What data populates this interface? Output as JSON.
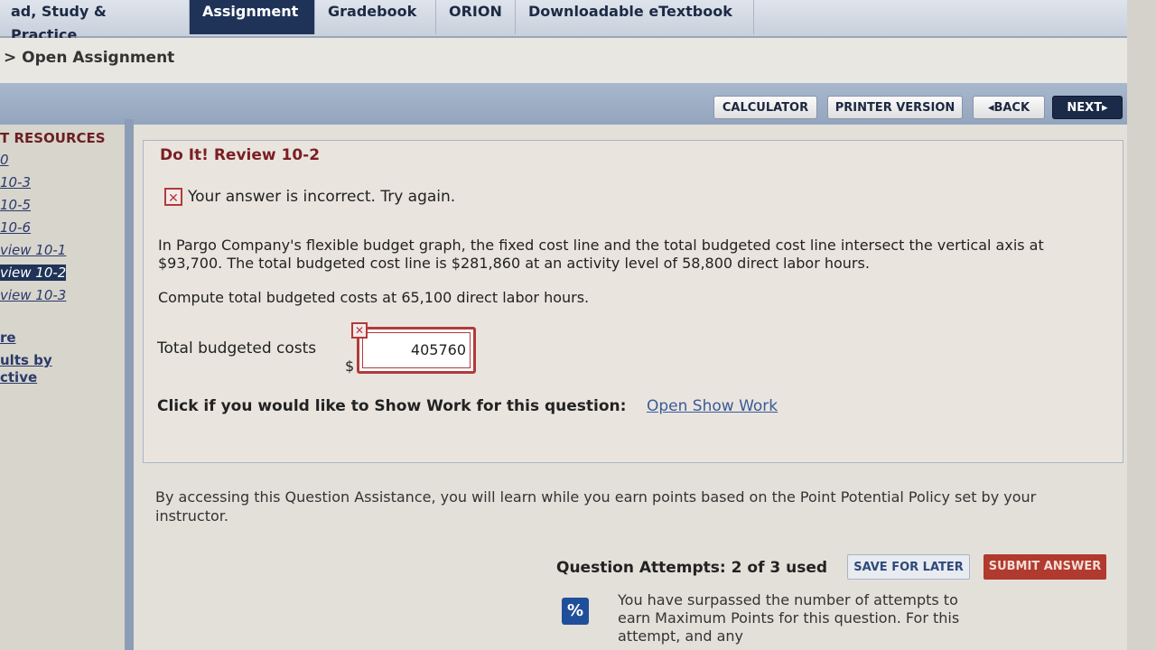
{
  "tabs": [
    {
      "label": "ad, Study & Practice"
    },
    {
      "label": "Assignment"
    },
    {
      "label": "Gradebook"
    },
    {
      "label": "ORION"
    },
    {
      "label": "Downloadable eTextbook"
    }
  ],
  "breadcrumb": "> Open Assignment",
  "toolbar": {
    "calculator": "CALCULATOR",
    "printer": "PRINTER VERSION",
    "back": "◂BACK",
    "next": "NEXT▸"
  },
  "sidebar": {
    "heading": "T RESOURCES",
    "links": [
      "0",
      "10-3",
      "10-5",
      "10-6",
      "view 10-1",
      "view 10-2",
      "view 10-3"
    ],
    "extra": [
      "re",
      "ults by",
      "ctive"
    ]
  },
  "question": {
    "title": "Do It! Review 10-2",
    "error": "Your answer is incorrect.  Try again.",
    "paragraph1": "In Pargo Company's flexible budget graph, the fixed cost line and the total budgeted cost line intersect the vertical axis at $93,700. The total budgeted cost line is $281,860 at an activity level of 58,800 direct labor hours.",
    "paragraph2": "Compute total budgeted costs at 65,100 direct labor hours.",
    "field_label": "Total budgeted costs",
    "currency": "$",
    "answer_value": "405760",
    "show_work_label": "Click if you would like to Show Work for this question:",
    "show_work_link": "Open Show Work"
  },
  "assistance": "By accessing this Question Assistance, you will learn while you earn points based on the Point Potential Policy set by your instructor.",
  "attempts": "Question Attempts: 2 of 3 used",
  "save_label": "SAVE FOR LATER",
  "submit_label": "SUBMIT ANSWER",
  "policy_icon": "%",
  "policy_text": "You have surpassed the number of attempts to earn Maximum Points for this question. For this attempt, and any"
}
